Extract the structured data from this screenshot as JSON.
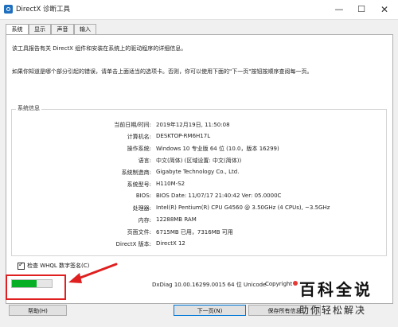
{
  "window": {
    "title": "DirectX 诊断工具",
    "min_glyph": "—",
    "max_glyph": "☐",
    "close_glyph": "✕"
  },
  "tabs": [
    {
      "label": "系统",
      "active": true
    },
    {
      "label": "显示",
      "active": false
    },
    {
      "label": "声音",
      "active": false
    },
    {
      "label": "输入",
      "active": false
    }
  ],
  "intro": {
    "line1": "该工具报告有关 DirectX 组件和安装在系统上的驱动程序的详细信息。",
    "line2": "如果你知道是哪个部分引起的错误，请单击上面适当的选项卡。否则，你可以使用下面的\"下一页\"按钮按顺序查阅每一页。"
  },
  "system_info": {
    "group_label": "系统信息",
    "rows": [
      {
        "label": "当前日期/时间:",
        "value": "2019年12月19日, 11:50:08"
      },
      {
        "label": "计算机名:",
        "value": "DESKTOP-RM6H17L"
      },
      {
        "label": "操作系统:",
        "value": "Windows 10 专业版 64 位 (10.0，版本 16299)"
      },
      {
        "label": "语言:",
        "value": "中文(简体) (区域设置: 中文(简体))"
      },
      {
        "label": "系统制造商:",
        "value": "Gigabyte Technology Co., Ltd."
      },
      {
        "label": "系统型号:",
        "value": "H110M-S2"
      },
      {
        "label": "BIOS:",
        "value": "BIOS Date: 11/07/17 21:40:42 Ver: 05.0000C"
      },
      {
        "label": "处理器:",
        "value": "Intel(R) Pentium(R) CPU G4560 @ 3.50GHz (4 CPUs), ~3.5GHz"
      },
      {
        "label": "内存:",
        "value": "12288MB RAM"
      },
      {
        "label": "页面文件:",
        "value": "6715MB 已用，7316MB 可用"
      },
      {
        "label": "DirectX 版本:",
        "value": "DirectX 12"
      }
    ]
  },
  "whql": {
    "label": "检查 WHQL 数字签名(C)",
    "checked": true
  },
  "progress": {
    "fraction": 0.62,
    "color": "#06b025"
  },
  "footer": {
    "version": "DxDiag 10.00.16299.0015 64 位 Unicode",
    "copyright": "Copyright"
  },
  "buttons": {
    "help": "帮助(H)",
    "next": "下一页(N)",
    "save": "保存所有信息"
  },
  "watermark": {
    "title": "百科全说",
    "subtitle": "助你轻松解决"
  },
  "colors": {
    "annotation": "#e02020",
    "accent": "#0078d7"
  }
}
